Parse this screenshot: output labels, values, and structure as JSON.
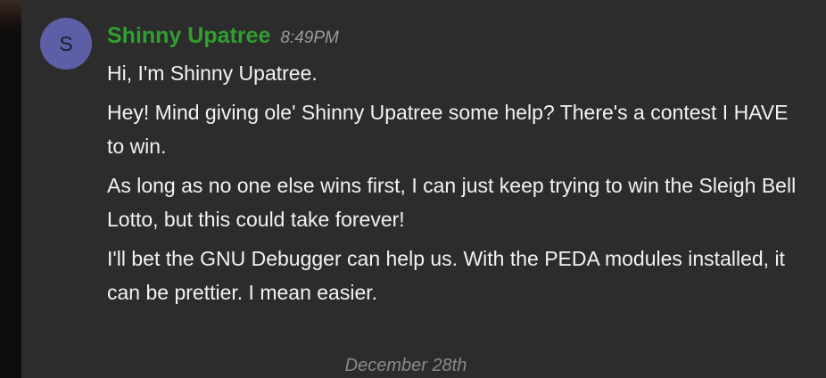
{
  "message": {
    "avatar_initial": "S",
    "author": "Shinny Upatree",
    "timestamp": "8:49PM",
    "lines": [
      "Hi, I'm Shinny Upatree.",
      "Hey! Mind giving ole' Shinny Upatree some help? There's a contest I HAVE to win.",
      "As long as no one else wins first, I can just keep trying to win the Sleigh Bell Lotto, but this could take forever!",
      "I'll bet the GNU Debugger can help us. With the PEDA modules installed, it can be prettier. I mean easier."
    ]
  },
  "divider": {
    "date": "December 28th"
  },
  "colors": {
    "author": "#2fa02f",
    "avatar": "#5d5fa6",
    "background": "#2c2c2c",
    "text": "#f2f2f2",
    "muted": "#9a9a9a"
  }
}
